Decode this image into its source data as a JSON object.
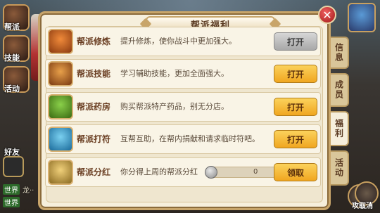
{
  "panel": {
    "title": "帮派福利"
  },
  "rows": [
    {
      "name": "帮派修炼",
      "desc": "提升修炼，使你战斗中更加强大。",
      "button": "打开",
      "button_state": "disabled"
    },
    {
      "name": "帮派技能",
      "desc": "学习辅助技能，更加全面强大。",
      "button": "打开",
      "button_state": "enabled"
    },
    {
      "name": "帮派药房",
      "desc": "购买帮派特产药品，别无分店。",
      "button": "打开",
      "button_state": "enabled"
    },
    {
      "name": "帮派打符",
      "desc": "互帮互助，在帮内捐献和请求临时符吧。",
      "button": "打开",
      "button_state": "enabled"
    },
    {
      "name": "帮派分红",
      "desc": "你分得上周的帮派分红",
      "button": "领取",
      "button_state": "enabled",
      "progress_value": "0"
    }
  ],
  "tabs": [
    "信息",
    "成员",
    "福利",
    "活动"
  ],
  "active_tab": "福利",
  "left_sidebar": [
    "帮派",
    "技能",
    "活动",
    "好友"
  ],
  "chat": {
    "tag": "世界",
    "partial": "龙··"
  },
  "right_bottom": [
    "攻击",
    "取消"
  ],
  "colors": {
    "button_orange": "#f0a620",
    "button_gray": "#a8a8a8",
    "panel_bg": "#f6efdc",
    "border_gold": "#c8a56a"
  }
}
